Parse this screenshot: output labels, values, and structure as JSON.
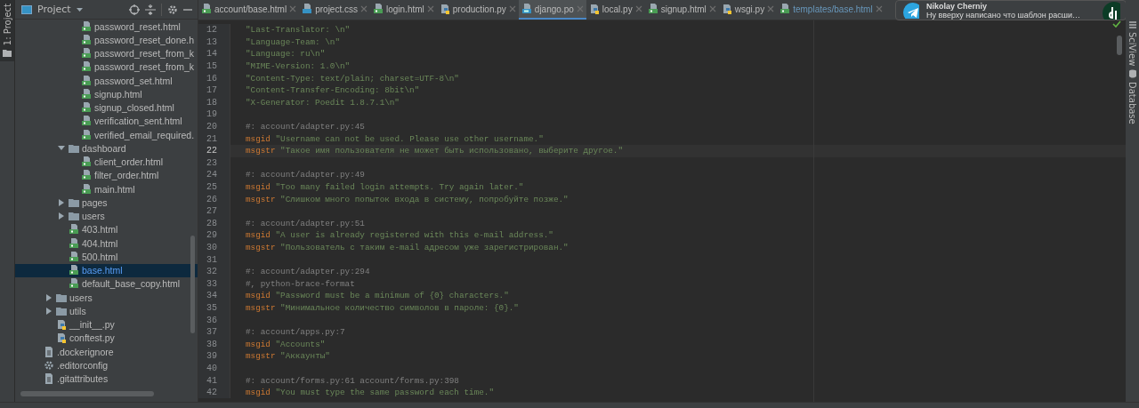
{
  "left_strip": {
    "label": "1: Project"
  },
  "project_panel": {
    "title": "Project",
    "tree": [
      {
        "children": [
          {
            "children": [
              {
                "children": [
                  {
                    "label": "password_reset.html",
                    "kind": "html"
                  },
                  {
                    "label": "password_reset_done.h",
                    "kind": "html"
                  },
                  {
                    "label": "password_reset_from_k",
                    "kind": "html"
                  },
                  {
                    "label": "password_reset_from_k",
                    "kind": "html"
                  },
                  {
                    "label": "password_set.html",
                    "kind": "html"
                  },
                  {
                    "label": "signup.html",
                    "kind": "html"
                  },
                  {
                    "label": "signup_closed.html",
                    "kind": "html"
                  },
                  {
                    "label": "verification_sent.html",
                    "kind": "html"
                  },
                  {
                    "label": "verified_email_required.",
                    "kind": "html"
                  }
                ]
              },
              {
                "label": "dashboard",
                "kind": "folder",
                "expanded": true,
                "selected": false,
                "children": [
                  {
                    "label": "client_order.html",
                    "kind": "html"
                  },
                  {
                    "label": "filter_order.html",
                    "kind": "html"
                  },
                  {
                    "label": "main.html",
                    "kind": "html"
                  }
                ]
              },
              {
                "label": "pages",
                "kind": "folder",
                "expanded": false
              },
              {
                "label": "users",
                "kind": "folder",
                "expanded": false
              },
              {
                "label": "403.html",
                "kind": "html",
                "selected": false
              },
              {
                "label": "404.html",
                "kind": "html",
                "selected": false
              },
              {
                "label": "500.html",
                "kind": "html",
                "selected": false
              },
              {
                "label": "base.html",
                "kind": "html",
                "selected": true
              },
              {
                "label": "default_base_copy.html",
                "kind": "html",
                "selected": false
              }
            ]
          },
          {
            "label": "users",
            "kind": "folder",
            "expanded": false
          },
          {
            "label": "utils",
            "kind": "folder",
            "expanded": false
          },
          {
            "label": "__init__.py",
            "kind": "python"
          },
          {
            "label": "conftest.py",
            "kind": "python"
          }
        ]
      },
      {
        "label": ".dockerignore",
        "kind": "file"
      },
      {
        "label": ".editorconfig",
        "kind": "config"
      },
      {
        "label": ".gitattributes",
        "kind": "file"
      }
    ]
  },
  "tabs": [
    {
      "label": "account/base.html",
      "kind": "html",
      "selected": false,
      "modified": false
    },
    {
      "label": "project.css",
      "kind": "css",
      "selected": false,
      "modified": false
    },
    {
      "label": "login.html",
      "kind": "html",
      "selected": false,
      "modified": false
    },
    {
      "label": "production.py",
      "kind": "python",
      "selected": false,
      "modified": false
    },
    {
      "label": "django.po",
      "kind": "po",
      "selected": true,
      "modified": false
    },
    {
      "label": "local.py",
      "kind": "python",
      "selected": false,
      "modified": false
    },
    {
      "label": "signup.html",
      "kind": "html",
      "selected": false,
      "modified": false
    },
    {
      "label": "wsgi.py",
      "kind": "python",
      "selected": false,
      "modified": false
    },
    {
      "label": "templates/base.html",
      "kind": "html",
      "selected": false,
      "modified": true
    }
  ],
  "code_lines": [
    {
      "number": "12",
      "kind": "string",
      "text": "\"Last-Translator: \\n\""
    },
    {
      "number": "13",
      "kind": "string",
      "text": "\"Language-Team: \\n\""
    },
    {
      "number": "14",
      "kind": "string",
      "text": "\"Language: ru\\n\""
    },
    {
      "number": "15",
      "kind": "string",
      "text": "\"MIME-Version: 1.0\\n\""
    },
    {
      "number": "16",
      "kind": "string",
      "text": "\"Content-Type: text/plain; charset=UTF-8\\n\""
    },
    {
      "number": "17",
      "kind": "string",
      "text": "\"Content-Transfer-Encoding: 8bit\\n\""
    },
    {
      "number": "18",
      "kind": "string",
      "text": "\"X-Generator: Poedit 1.8.7.1\\n\""
    },
    {
      "number": "19",
      "kind": "blank"
    },
    {
      "number": "20",
      "kind": "comment",
      "text": "#: account/adapter.py:45"
    },
    {
      "number": "21",
      "kind": "entry",
      "keyword": "msgid",
      "text": "\"Username can not be used. Please use other username.\""
    },
    {
      "number": "22",
      "kind": "entry",
      "keyword": "msgstr",
      "text": "\"Такое имя пользователя не может быть использовано, выберите другое.\"",
      "current": true
    },
    {
      "number": "23",
      "kind": "blank"
    },
    {
      "number": "24",
      "kind": "comment",
      "text": "#: account/adapter.py:49"
    },
    {
      "number": "25",
      "kind": "entry",
      "keyword": "msgid",
      "text": "\"Too many failed login attempts. Try again later.\""
    },
    {
      "number": "26",
      "kind": "entry",
      "keyword": "msgstr",
      "text": "\"Слишком много попыток входа в систему, попробуйте позже.\""
    },
    {
      "number": "27",
      "kind": "blank"
    },
    {
      "number": "28",
      "kind": "comment",
      "text": "#: account/adapter.py:51"
    },
    {
      "number": "29",
      "kind": "entry",
      "keyword": "msgid",
      "text": "\"A user is already registered with this e-mail address.\""
    },
    {
      "number": "30",
      "kind": "entry",
      "keyword": "msgstr",
      "text": "\"Пользователь с таким e-mail адресом уже зарегистрирован.\""
    },
    {
      "number": "31",
      "kind": "blank"
    },
    {
      "number": "32",
      "kind": "comment",
      "text": "#: account/adapter.py:294"
    },
    {
      "number": "33",
      "kind": "comment",
      "text": "#, python-brace-format"
    },
    {
      "number": "34",
      "kind": "entry",
      "keyword": "msgid",
      "text": "\"Password must be a minimum of {0} characters.\""
    },
    {
      "number": "35",
      "kind": "entry",
      "keyword": "msgstr",
      "text": "\"Минимальное количество символов в пароле: {0}.\""
    },
    {
      "number": "36",
      "kind": "blank"
    },
    {
      "number": "37",
      "kind": "comment",
      "text": "#: account/apps.py:7"
    },
    {
      "number": "38",
      "kind": "entry",
      "keyword": "msgid",
      "text": "\"Accounts\""
    },
    {
      "number": "39",
      "kind": "entry",
      "keyword": "msgstr",
      "text": "\"Аккаунты\""
    },
    {
      "number": "40",
      "kind": "blank"
    },
    {
      "number": "41",
      "kind": "comment",
      "text": "#: account/forms.py:61 account/forms.py:398"
    },
    {
      "number": "42",
      "kind": "entry",
      "keyword": "msgid",
      "text": "\"You must type the same password each time.\""
    }
  ],
  "notification": {
    "sender": "Nikolay Cherniy",
    "message": "Ну вверху написано что шаблон расши…"
  },
  "right_strip": [
    {
      "label": "SciView"
    },
    {
      "label": "Database"
    }
  ]
}
